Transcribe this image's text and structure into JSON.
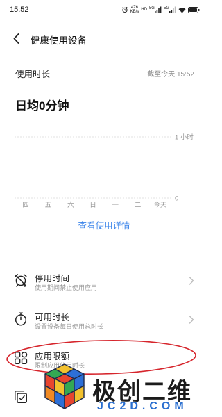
{
  "status_bar": {
    "time": "15:52",
    "net_speed_value": "476",
    "net_speed_unit": "KB/s",
    "hd_label": "HD",
    "signal_labels": [
      "5G",
      "5G"
    ],
    "icons": [
      "alarm-icon",
      "signal-icon",
      "signal-icon",
      "wifi-icon",
      "battery-icon"
    ]
  },
  "header": {
    "back_icon": "chevron-left-icon",
    "title": "健康使用设备"
  },
  "usage": {
    "label": "使用时长",
    "as_of": "截至今天 15:52",
    "daily_avg": "日均0分钟"
  },
  "chart_data": {
    "type": "bar",
    "categories": [
      "四",
      "五",
      "六",
      "日",
      "一",
      "二",
      "今天"
    ],
    "values": [
      0,
      0,
      0,
      0,
      0,
      0,
      0
    ],
    "yticks": [
      "0",
      "1 小时"
    ],
    "ylim": [
      0,
      1
    ],
    "grid": true
  },
  "details_link": "查看使用详情",
  "settings": [
    {
      "title": "停用时间",
      "subtitle": "使用期间禁止使用应用",
      "icon": "alarm-off-icon"
    },
    {
      "title": "可用时长",
      "subtitle": "设置设备每日使用总时长",
      "icon": "timer-icon"
    },
    {
      "title": "应用限额",
      "subtitle": "限制应用使用时长",
      "icon": "app-grid-icon"
    },
    {
      "icon": "checklist-icon"
    }
  ],
  "watermark": {
    "brand": "极创二维",
    "domain": "JC2D.COM"
  },
  "colors": {
    "accent": "#3a84ea",
    "highlight": "#d6252c",
    "watermark_blue": "#2a6fd0"
  }
}
